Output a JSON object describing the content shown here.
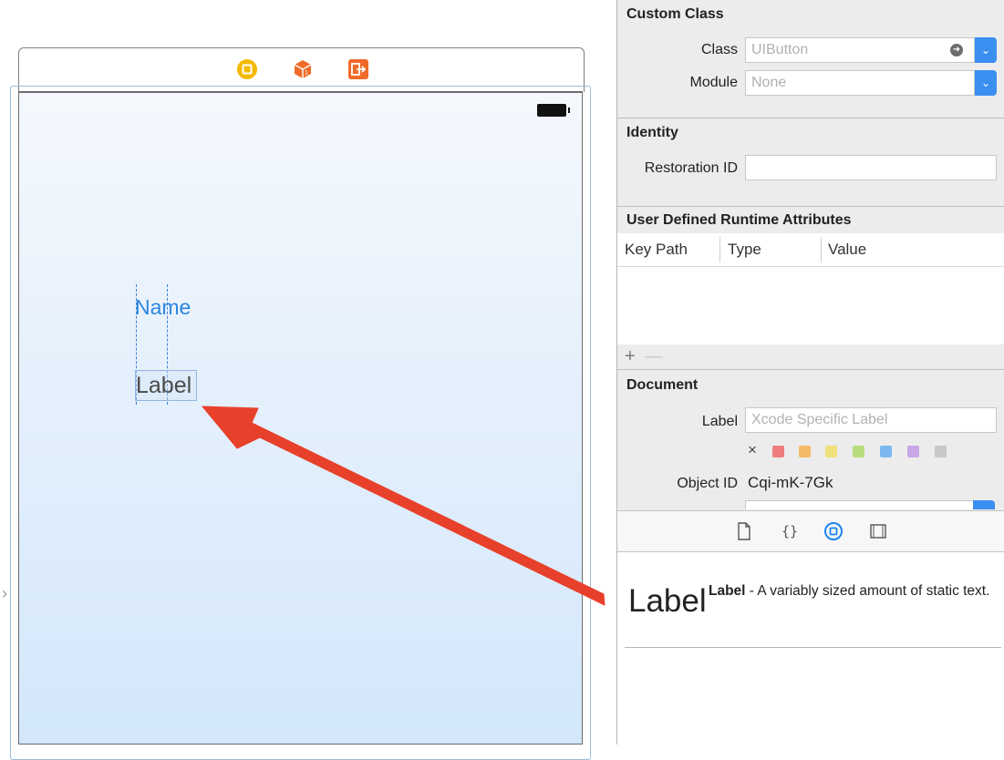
{
  "storyboard": {
    "scene_dock_icons": [
      "view-controller-icon",
      "first-responder-icon",
      "exit-icon"
    ],
    "name_button_title": "Name",
    "label_text": "Label"
  },
  "inspector": {
    "custom_class": {
      "title": "Custom Class",
      "class_label": "Class",
      "class_placeholder": "UIButton",
      "module_label": "Module",
      "module_placeholder": "None"
    },
    "identity": {
      "title": "Identity",
      "restoration_label": "Restoration ID",
      "restoration_value": ""
    },
    "udra": {
      "title": "User Defined Runtime Attributes",
      "columns": [
        "Key Path",
        "Type",
        "Value"
      ],
      "add": "+",
      "remove": "—"
    },
    "document": {
      "title": "Document",
      "label_label": "Label",
      "label_placeholder": "Xcode Specific Label",
      "clear_symbol": "×",
      "swatch_colors": [
        "#ef7d7d",
        "#f5b968",
        "#f0e27a",
        "#b9dd7c",
        "#7bb9f0",
        "#c9a6e8",
        "#c8c8c8"
      ],
      "object_id_label": "Object ID",
      "object_id_value": "Cqi-mK-7Gk"
    },
    "library_tabs": [
      "file-template-icon",
      "code-snippet-icon",
      "object-library-icon",
      "media-library-icon"
    ],
    "library_item": {
      "preview": "Label",
      "name": "Label",
      "description": " - A variably sized amount of static text."
    }
  },
  "colors": {
    "accent_blue": "#3a8ff0",
    "arrow_red": "#e8412b",
    "name_blue": "#2d86e0"
  }
}
